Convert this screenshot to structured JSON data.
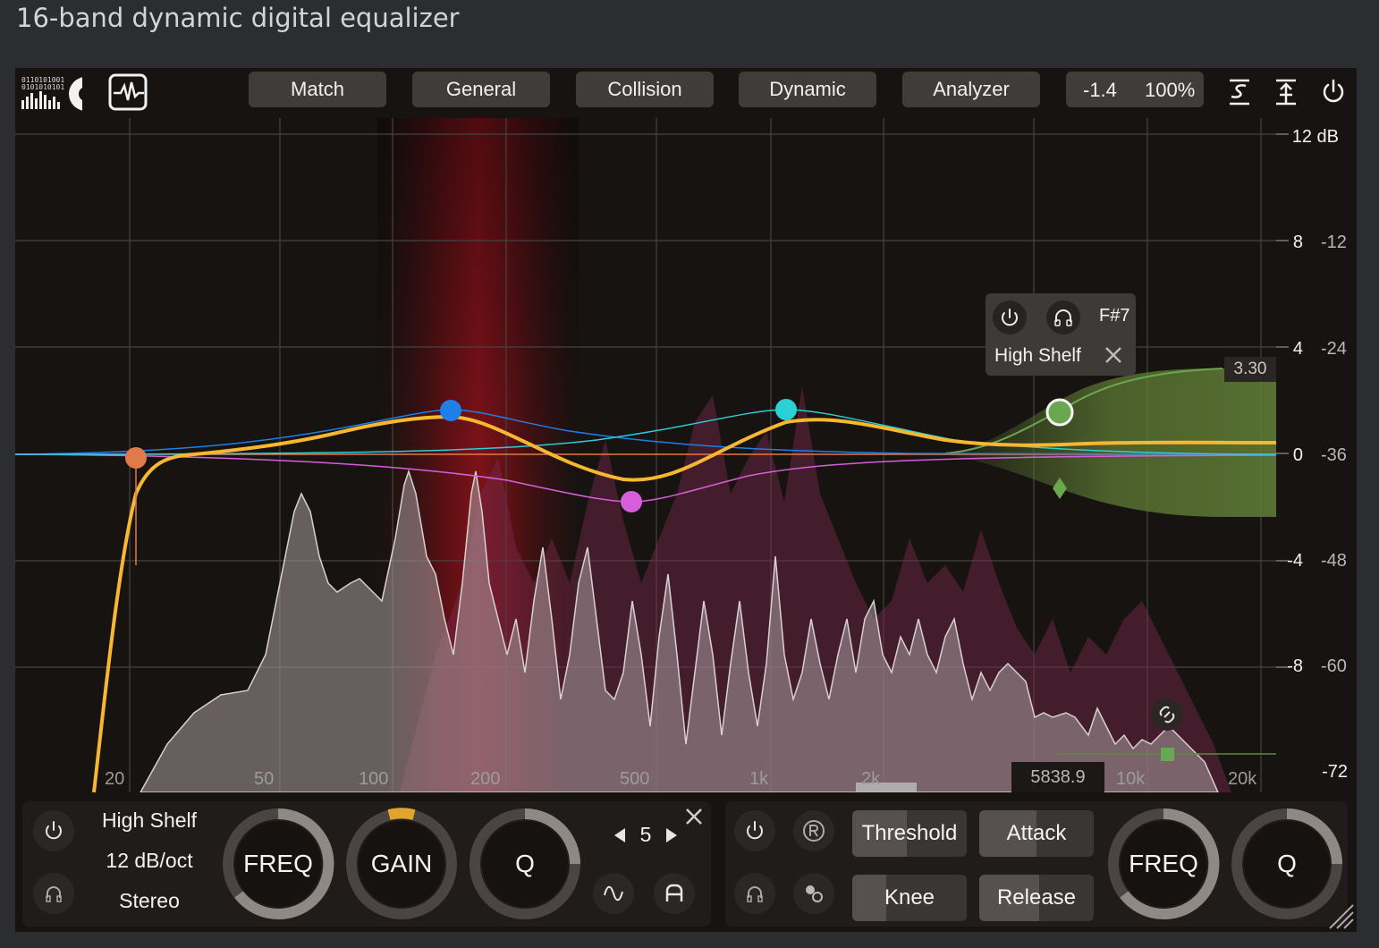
{
  "page": {
    "title": "16-band dynamic digital equalizer"
  },
  "toolbar": {
    "tabs": [
      "Match",
      "General",
      "Collision",
      "Dynamic",
      "Analyzer"
    ],
    "output_gain": "-1.4",
    "scale": "100%"
  },
  "graph": {
    "db_labels": [
      "12 dB",
      "8",
      "4",
      "0",
      "-4",
      "-8",
      "-72"
    ],
    "analyzer_labels": [
      "-12",
      "-24",
      "-36",
      "-48",
      "-60"
    ],
    "freq_labels": [
      "20",
      "50",
      "100",
      "200",
      "500",
      "1k",
      "2k",
      "10k",
      "20k"
    ],
    "cursor_freq": "5838.9",
    "peak_value": "3.30",
    "band_popup": {
      "note": "F#7",
      "type": "High Shelf"
    },
    "bands": [
      {
        "id": 1,
        "color": "#e07a4a",
        "freq": 20,
        "gain_db": 0
      },
      {
        "id": 2,
        "color": "#1e7fe8",
        "freq": 150,
        "gain_db": 1.7
      },
      {
        "id": 3,
        "color": "#d65fd9",
        "freq": 500,
        "gain_db": -1.8
      },
      {
        "id": 4,
        "color": "#2ccfd6",
        "freq": 1200,
        "gain_db": 1.7
      },
      {
        "id": 5,
        "color": "#6aa84f",
        "freq": 5800,
        "gain_db": 1.6
      }
    ]
  },
  "band_panel": {
    "filter_type": "High Shelf",
    "slope": "12 dB/oct",
    "channel": "Stereo",
    "band_number": "5",
    "knobs": {
      "freq": "FREQ",
      "gain": "GAIN",
      "q": "Q"
    }
  },
  "dynamic_panel": {
    "threshold": "Threshold",
    "attack": "Attack",
    "knee": "Knee",
    "release": "Release",
    "knobs": {
      "freq": "FREQ",
      "q": "Q"
    },
    "threshold_fill": 0.48,
    "attack_fill": 0.5,
    "knee_fill": 0.3,
    "release_fill": 0.52
  },
  "colors": {
    "eq_curve": "#f7b731",
    "background": "#171311",
    "accent_gain": "#e0a52a"
  }
}
